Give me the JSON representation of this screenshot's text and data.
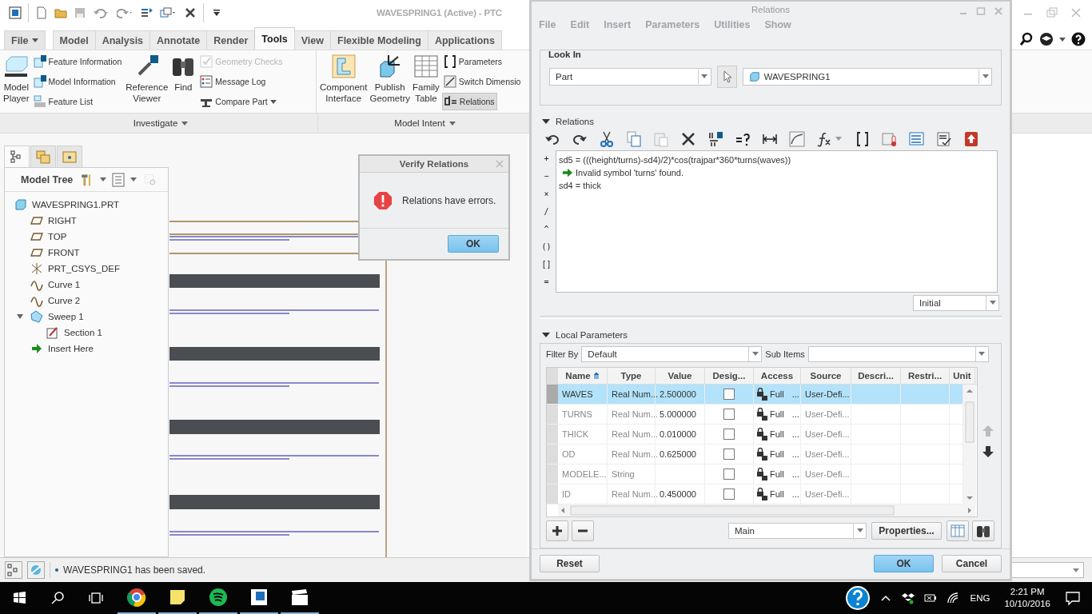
{
  "app": {
    "title": "WAVESPRING1 (Active) - PTC"
  },
  "ribbon_tabs": [
    {
      "label": "File",
      "selected": false,
      "kind": "menu"
    },
    {
      "label": "Model",
      "selected": false,
      "kind": "tab"
    },
    {
      "label": "Analysis",
      "selected": false,
      "kind": "tab"
    },
    {
      "label": "Annotate",
      "selected": false,
      "kind": "tab"
    },
    {
      "label": "Render",
      "selected": false,
      "kind": "tab"
    },
    {
      "label": "Tools",
      "selected": true,
      "kind": "tab"
    },
    {
      "label": "View",
      "selected": false,
      "kind": "tab"
    },
    {
      "label": "Flexible Modeling",
      "selected": false,
      "kind": "tab"
    },
    {
      "label": "Applications",
      "selected": false,
      "kind": "tab"
    }
  ],
  "ribbon_groups": [
    {
      "label": "Investigate",
      "columns": [
        {
          "kind": "large",
          "lines": [
            "Model",
            "Player"
          ]
        },
        {
          "kind": "stack",
          "items": [
            {
              "label": "Feature Information",
              "disabled": false,
              "dropdown": false,
              "selected": false
            },
            {
              "label": "Model Information",
              "disabled": false,
              "dropdown": false,
              "selected": false
            },
            {
              "label": "Feature List",
              "disabled": false,
              "dropdown": false,
              "selected": false
            }
          ]
        },
        {
          "kind": "large",
          "lines": [
            "Reference",
            "Viewer"
          ]
        },
        {
          "kind": "large",
          "lines": [
            "Find"
          ]
        },
        {
          "kind": "stack",
          "items": [
            {
              "label": "Geometry Checks",
              "disabled": true,
              "dropdown": false,
              "selected": false
            },
            {
              "label": "Message Log",
              "disabled": false,
              "dropdown": false,
              "selected": false
            },
            {
              "label": "Compare Part",
              "disabled": false,
              "dropdown": true,
              "selected": false
            }
          ]
        }
      ]
    },
    {
      "label": "Model Intent",
      "columns": [
        {
          "kind": "large",
          "lines": [
            "Component",
            "Interface"
          ]
        },
        {
          "kind": "large",
          "lines": [
            "Publish",
            "Geometry"
          ]
        },
        {
          "kind": "large",
          "lines": [
            "Family",
            "Table"
          ]
        },
        {
          "kind": "stack",
          "items": [
            {
              "label": "Parameters",
              "disabled": false,
              "dropdown": false,
              "selected": false
            },
            {
              "label": "Switch Dimensio",
              "disabled": false,
              "dropdown": false,
              "selected": false
            },
            {
              "label": "Relations",
              "disabled": false,
              "dropdown": false,
              "selected": true
            }
          ]
        }
      ]
    }
  ],
  "model_tree": {
    "tabs": [
      {
        "selected": true
      },
      {
        "selected": false
      },
      {
        "selected": false
      }
    ],
    "title": "Model Tree",
    "items": [
      {
        "label": "WAVESPRING1.PRT",
        "kind": "part",
        "children": [
          {
            "label": "RIGHT",
            "kind": "plane"
          },
          {
            "label": "TOP",
            "kind": "plane"
          },
          {
            "label": "FRONT",
            "kind": "plane"
          },
          {
            "label": "PRT_CSYS_DEF",
            "kind": "csys"
          },
          {
            "label": "Curve 1",
            "kind": "curve"
          },
          {
            "label": "Curve 2",
            "kind": "curve"
          },
          {
            "label": "Sweep 1",
            "kind": "sweep",
            "expanded": true,
            "children": [
              {
                "label": "Section 1",
                "kind": "section"
              }
            ]
          },
          {
            "label": "Insert Here",
            "kind": "insert"
          }
        ]
      }
    ]
  },
  "status_bar": {
    "message": "WAVESPRING1 has been saved."
  },
  "verify_dialog": {
    "title": "Verify Relations",
    "message": "Relations have errors.",
    "button": "OK"
  },
  "relations_dialog": {
    "title": "Relations",
    "menus": [
      {
        "label": "File",
        "disabled": true
      },
      {
        "label": "Edit",
        "disabled": true
      },
      {
        "label": "Insert",
        "disabled": true
      },
      {
        "label": "Parameters",
        "disabled": true
      },
      {
        "label": "Utilities",
        "disabled": true
      },
      {
        "label": "Show",
        "disabled": true
      }
    ],
    "look_in": {
      "label": "Look In",
      "type": "Part",
      "object": "WAVESPRING1"
    },
    "relations": {
      "label": "Relations",
      "expanded": true,
      "operators": [
        "+",
        "−",
        "×",
        "/",
        "^",
        "()",
        "[]",
        "="
      ],
      "lines": [
        {
          "kind": "relation",
          "text": "sd5 = (((height/turns)-sd4)/2)*cos(trajpar*360*turns(waves))"
        },
        {
          "kind": "error",
          "text": "Invalid symbol 'turns' found."
        },
        {
          "kind": "relation",
          "text": "sd4 = thick"
        }
      ],
      "mode": "Initial"
    },
    "local_parameters": {
      "label": "Local Parameters",
      "expanded": true,
      "filter_label": "Filter By",
      "filter": "Default",
      "sub_items_label": "Sub Items",
      "columns": [
        "Name",
        "Type",
        "Value",
        "Desig...",
        "Access",
        "Source",
        "Descri...",
        "Restri...",
        "Unit"
      ],
      "rows": [
        {
          "name": "WAVES",
          "type": "Real Num...",
          "value": "2.500000",
          "designate": false,
          "access": "Full",
          "access_more": "...",
          "source": "User-Defi...",
          "selected": true
        },
        {
          "name": "TURNS",
          "type": "Real Num...",
          "value": "5.000000",
          "designate": false,
          "access": "Full",
          "access_more": "...",
          "source": "User-Defi...",
          "selected": false
        },
        {
          "name": "THICK",
          "type": "Real Num...",
          "value": "0.010000",
          "designate": false,
          "access": "Full",
          "access_more": "...",
          "source": "User-Defi...",
          "selected": false
        },
        {
          "name": "OD",
          "type": "Real Num...",
          "value": "0.625000",
          "designate": false,
          "access": "Full",
          "access_more": "...",
          "source": "User-Defi...",
          "selected": false
        },
        {
          "name": "MODELE...",
          "type": "String",
          "designate": false,
          "access": "Full",
          "access_more": "...",
          "source": "User-Defi...",
          "selected": false
        },
        {
          "name": "ID",
          "type": "Real Num...",
          "value": "0.450000",
          "designate": false,
          "access": "Full",
          "access_more": "...",
          "source": "User-Defi...",
          "selected": false
        }
      ],
      "view": "Main",
      "properties_button": "Properties..."
    },
    "buttons": [
      {
        "label": "Reset",
        "kind": "secondary"
      },
      {
        "label": "OK",
        "kind": "primary"
      },
      {
        "label": "Cancel",
        "kind": "secondary"
      }
    ]
  },
  "taskbar": {
    "apps": [
      {
        "kind": "browser",
        "running": true
      },
      {
        "kind": "note",
        "running": true
      },
      {
        "kind": "music",
        "running": true
      },
      {
        "kind": "app",
        "running": true
      },
      {
        "kind": "video",
        "running": true
      }
    ],
    "language": "ENG",
    "time": "2:21 PM",
    "date": "10/10/2016"
  }
}
